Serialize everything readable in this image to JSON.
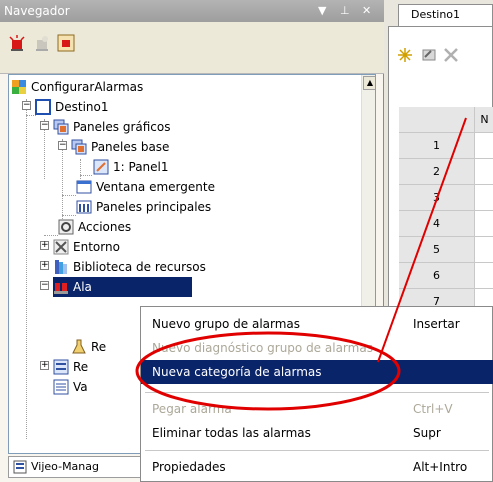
{
  "navigator": {
    "title": "Navegador",
    "controls": [
      "▼",
      "⊥",
      "✕"
    ],
    "toolbar_icons": [
      "alarm-red-icon",
      "alarm-gray-icon",
      "alarm-box-icon"
    ],
    "tree": [
      {
        "label": "ConfigurarAlarmas",
        "icon": "project-icon"
      },
      {
        "label": "Destino1",
        "icon": "target-icon"
      },
      {
        "label": "Paneles gráficos",
        "icon": "panels-icon"
      },
      {
        "label": "Paneles base",
        "icon": "panels-icon"
      },
      {
        "label": "1: Panel1",
        "icon": "panel-icon"
      },
      {
        "label": "Ventana emergente",
        "icon": "window-icon"
      },
      {
        "label": "Paneles principales",
        "icon": "panels-icon"
      },
      {
        "label": "Acciones",
        "icon": "actions-icon"
      },
      {
        "label": "Entorno",
        "icon": "tools-icon"
      },
      {
        "label": "Biblioteca de recursos",
        "icon": "library-icon"
      },
      {
        "label": "Ala",
        "icon": "alarms-icon"
      },
      {
        "label": "Re",
        "icon": "flask-icon"
      },
      {
        "label": "Re",
        "icon": "report-icon"
      },
      {
        "label": "Va",
        "icon": "variables-icon"
      }
    ],
    "bottom_tab": "Vijeo-Manag"
  },
  "destination": {
    "tab_label": "Destino1",
    "header_letter": "N",
    "rows": [
      "1",
      "2",
      "3",
      "4",
      "5",
      "6",
      "7"
    ]
  },
  "context_menu": {
    "items": [
      {
        "label": "Nuevo grupo de alarmas",
        "shortcut": "Insertar",
        "disabled": false,
        "highlighted": false
      },
      {
        "label": "Nuevo diagnóstico grupo de alarmas",
        "shortcut": "",
        "disabled": true,
        "highlighted": false
      },
      {
        "label": "Nueva categoría de alarmas",
        "shortcut": "",
        "disabled": false,
        "highlighted": true
      },
      {
        "label": "Pegar alarma",
        "shortcut": "Ctrl+V",
        "disabled": true,
        "highlighted": false
      },
      {
        "label": "Eliminar todas las alarmas",
        "shortcut": "Supr",
        "disabled": false,
        "highlighted": false
      },
      {
        "label": "Propiedades",
        "shortcut": "Alt+Intro",
        "disabled": false,
        "highlighted": false
      }
    ]
  },
  "colors": {
    "highlight": "#0a246a",
    "annotation": "#e00000",
    "title_bar": "#a8a8a8"
  }
}
